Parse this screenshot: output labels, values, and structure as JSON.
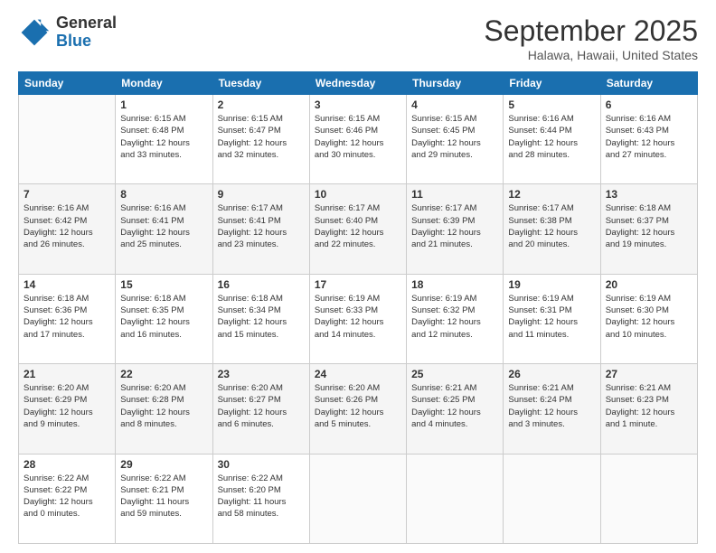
{
  "logo": {
    "line1": "General",
    "line2": "Blue"
  },
  "title": "September 2025",
  "subtitle": "Halawa, Hawaii, United States",
  "days_of_week": [
    "Sunday",
    "Monday",
    "Tuesday",
    "Wednesday",
    "Thursday",
    "Friday",
    "Saturday"
  ],
  "weeks": [
    [
      {
        "day": "",
        "info": ""
      },
      {
        "day": "1",
        "info": "Sunrise: 6:15 AM\nSunset: 6:48 PM\nDaylight: 12 hours\nand 33 minutes."
      },
      {
        "day": "2",
        "info": "Sunrise: 6:15 AM\nSunset: 6:47 PM\nDaylight: 12 hours\nand 32 minutes."
      },
      {
        "day": "3",
        "info": "Sunrise: 6:15 AM\nSunset: 6:46 PM\nDaylight: 12 hours\nand 30 minutes."
      },
      {
        "day": "4",
        "info": "Sunrise: 6:15 AM\nSunset: 6:45 PM\nDaylight: 12 hours\nand 29 minutes."
      },
      {
        "day": "5",
        "info": "Sunrise: 6:16 AM\nSunset: 6:44 PM\nDaylight: 12 hours\nand 28 minutes."
      },
      {
        "day": "6",
        "info": "Sunrise: 6:16 AM\nSunset: 6:43 PM\nDaylight: 12 hours\nand 27 minutes."
      }
    ],
    [
      {
        "day": "7",
        "info": "Sunrise: 6:16 AM\nSunset: 6:42 PM\nDaylight: 12 hours\nand 26 minutes."
      },
      {
        "day": "8",
        "info": "Sunrise: 6:16 AM\nSunset: 6:41 PM\nDaylight: 12 hours\nand 25 minutes."
      },
      {
        "day": "9",
        "info": "Sunrise: 6:17 AM\nSunset: 6:41 PM\nDaylight: 12 hours\nand 23 minutes."
      },
      {
        "day": "10",
        "info": "Sunrise: 6:17 AM\nSunset: 6:40 PM\nDaylight: 12 hours\nand 22 minutes."
      },
      {
        "day": "11",
        "info": "Sunrise: 6:17 AM\nSunset: 6:39 PM\nDaylight: 12 hours\nand 21 minutes."
      },
      {
        "day": "12",
        "info": "Sunrise: 6:17 AM\nSunset: 6:38 PM\nDaylight: 12 hours\nand 20 minutes."
      },
      {
        "day": "13",
        "info": "Sunrise: 6:18 AM\nSunset: 6:37 PM\nDaylight: 12 hours\nand 19 minutes."
      }
    ],
    [
      {
        "day": "14",
        "info": "Sunrise: 6:18 AM\nSunset: 6:36 PM\nDaylight: 12 hours\nand 17 minutes."
      },
      {
        "day": "15",
        "info": "Sunrise: 6:18 AM\nSunset: 6:35 PM\nDaylight: 12 hours\nand 16 minutes."
      },
      {
        "day": "16",
        "info": "Sunrise: 6:18 AM\nSunset: 6:34 PM\nDaylight: 12 hours\nand 15 minutes."
      },
      {
        "day": "17",
        "info": "Sunrise: 6:19 AM\nSunset: 6:33 PM\nDaylight: 12 hours\nand 14 minutes."
      },
      {
        "day": "18",
        "info": "Sunrise: 6:19 AM\nSunset: 6:32 PM\nDaylight: 12 hours\nand 12 minutes."
      },
      {
        "day": "19",
        "info": "Sunrise: 6:19 AM\nSunset: 6:31 PM\nDaylight: 12 hours\nand 11 minutes."
      },
      {
        "day": "20",
        "info": "Sunrise: 6:19 AM\nSunset: 6:30 PM\nDaylight: 12 hours\nand 10 minutes."
      }
    ],
    [
      {
        "day": "21",
        "info": "Sunrise: 6:20 AM\nSunset: 6:29 PM\nDaylight: 12 hours\nand 9 minutes."
      },
      {
        "day": "22",
        "info": "Sunrise: 6:20 AM\nSunset: 6:28 PM\nDaylight: 12 hours\nand 8 minutes."
      },
      {
        "day": "23",
        "info": "Sunrise: 6:20 AM\nSunset: 6:27 PM\nDaylight: 12 hours\nand 6 minutes."
      },
      {
        "day": "24",
        "info": "Sunrise: 6:20 AM\nSunset: 6:26 PM\nDaylight: 12 hours\nand 5 minutes."
      },
      {
        "day": "25",
        "info": "Sunrise: 6:21 AM\nSunset: 6:25 PM\nDaylight: 12 hours\nand 4 minutes."
      },
      {
        "day": "26",
        "info": "Sunrise: 6:21 AM\nSunset: 6:24 PM\nDaylight: 12 hours\nand 3 minutes."
      },
      {
        "day": "27",
        "info": "Sunrise: 6:21 AM\nSunset: 6:23 PM\nDaylight: 12 hours\nand 1 minute."
      }
    ],
    [
      {
        "day": "28",
        "info": "Sunrise: 6:22 AM\nSunset: 6:22 PM\nDaylight: 12 hours\nand 0 minutes."
      },
      {
        "day": "29",
        "info": "Sunrise: 6:22 AM\nSunset: 6:21 PM\nDaylight: 11 hours\nand 59 minutes."
      },
      {
        "day": "30",
        "info": "Sunrise: 6:22 AM\nSunset: 6:20 PM\nDaylight: 11 hours\nand 58 minutes."
      },
      {
        "day": "",
        "info": ""
      },
      {
        "day": "",
        "info": ""
      },
      {
        "day": "",
        "info": ""
      },
      {
        "day": "",
        "info": ""
      }
    ]
  ]
}
